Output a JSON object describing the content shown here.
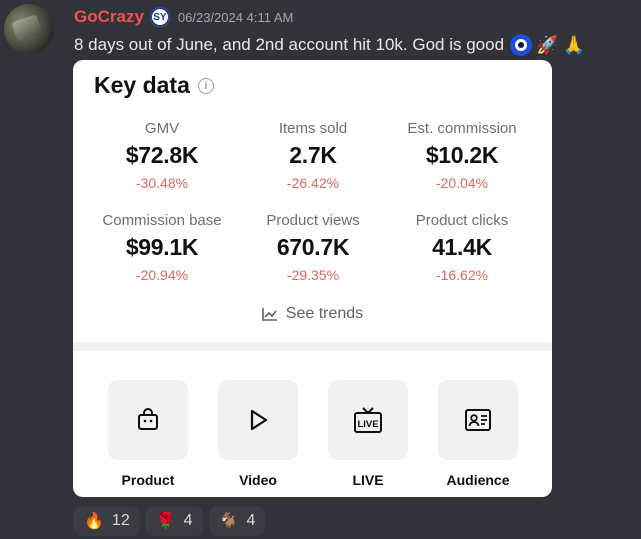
{
  "message": {
    "username": "GoCrazy",
    "badge_text": "SY",
    "timestamp": "06/23/2024 4:11 AM",
    "text": "8 days out of June, and 2nd account hit 10k. God is good",
    "emojis": [
      "nazar-amulet-icon",
      "rocket-icon",
      "folded-hands-icon"
    ]
  },
  "card": {
    "title": "Key data",
    "metrics": [
      {
        "label": "GMV",
        "value": "$72.8K",
        "change": "-30.48%"
      },
      {
        "label": "Items sold",
        "value": "2.7K",
        "change": "-26.42%"
      },
      {
        "label": "Est. commission",
        "value": "$10.2K",
        "change": "-20.04%"
      },
      {
        "label": "Commission base",
        "value": "$99.1K",
        "change": "-20.94%"
      },
      {
        "label": "Product views",
        "value": "670.7K",
        "change": "-29.35%"
      },
      {
        "label": "Product clicks",
        "value": "41.4K",
        "change": "-16.62%"
      }
    ],
    "see_trends": "See trends",
    "nav": [
      {
        "label": "Product",
        "icon": "shopping-bag-icon"
      },
      {
        "label": "Video",
        "icon": "play-icon"
      },
      {
        "label": "LIVE",
        "icon": "live-tv-icon"
      },
      {
        "label": "Audience",
        "icon": "id-card-icon"
      }
    ]
  },
  "reactions": [
    {
      "emoji": "fire-icon",
      "count": "12"
    },
    {
      "emoji": "rose-icon",
      "count": "4"
    },
    {
      "emoji": "goat-icon",
      "count": "4"
    }
  ],
  "colors": {
    "username": "#f0504f",
    "negative_change": "#e0675f",
    "background": "#313338"
  }
}
